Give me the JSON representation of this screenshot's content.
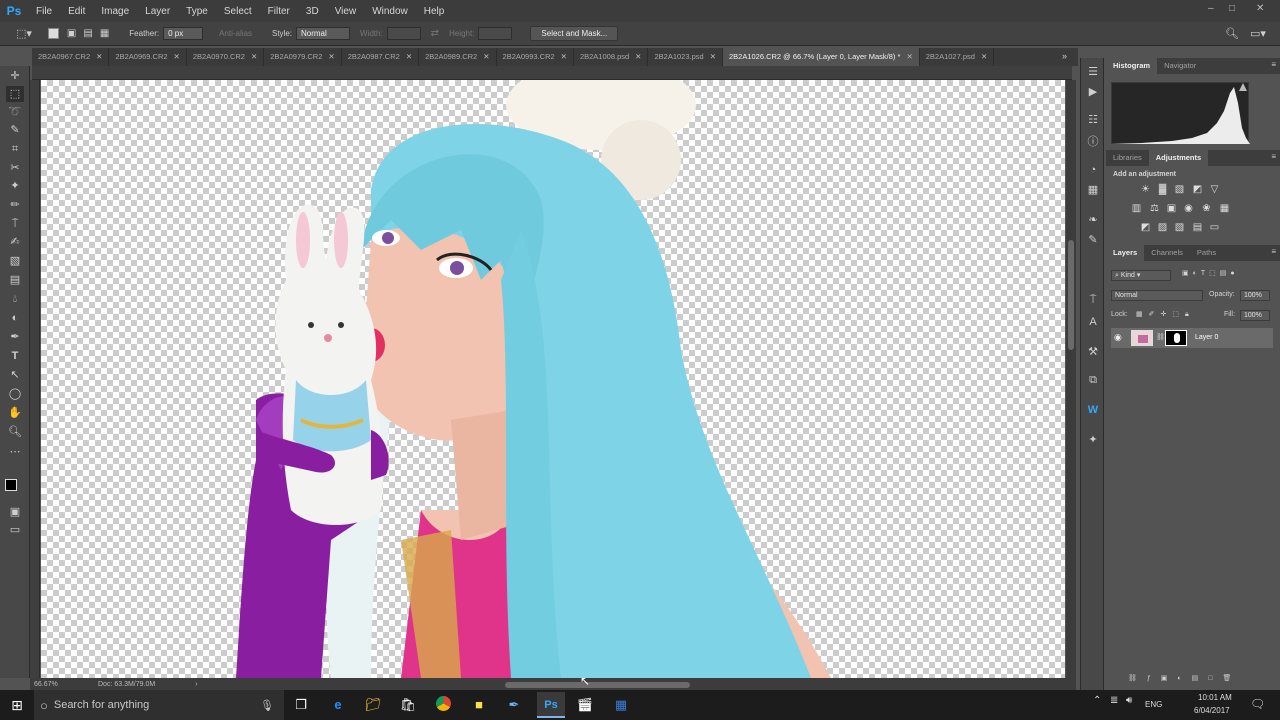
{
  "app": {
    "logo": "Ps"
  },
  "menu": [
    "File",
    "Edit",
    "Image",
    "Layer",
    "Type",
    "Select",
    "Filter",
    "3D",
    "View",
    "Window",
    "Help"
  ],
  "window_controls": [
    "–",
    "□",
    "✕"
  ],
  "options": {
    "feather_label": "Feather:",
    "feather_value": "0 px",
    "antialias_label": "Anti-alias",
    "style_label": "Style:",
    "style_value": "Normal",
    "width_label": "Width:",
    "height_label": "Height:",
    "select_mask_button": "Select and Mask..."
  },
  "tabs": [
    {
      "label": "2B2A0967.CR2",
      "active": false
    },
    {
      "label": "2B2A0969.CR2",
      "active": false
    },
    {
      "label": "2B2A0970.CR2",
      "active": false
    },
    {
      "label": "2B2A0979.CR2",
      "active": false
    },
    {
      "label": "2B2A0987.CR2",
      "active": false
    },
    {
      "label": "2B2A0989.CR2",
      "active": false
    },
    {
      "label": "2B2A0993.CR2",
      "active": false
    },
    {
      "label": "2B2A1008.psd",
      "active": false
    },
    {
      "label": "2B2A1023.psd",
      "active": false
    },
    {
      "label": "2B2A1026.CR2 @ 66.7% (Layer 0, Layer Mask/8) *",
      "active": true
    },
    {
      "label": "2B2A1027.psd",
      "active": false
    }
  ],
  "status": {
    "zoom": "66.67%",
    "doc": "Doc: 63.3M/79.0M"
  },
  "panels": {
    "histogram_tab": "Histogram",
    "navigator_tab": "Navigator",
    "libraries_tab": "Libraries",
    "adjustments_tab": "Adjustments",
    "add_adjustment": "Add an adjustment",
    "layers_tab": "Layers",
    "channels_tab": "Channels",
    "paths_tab": "Paths",
    "kind_filter": "Kind",
    "blend_mode": "Normal",
    "opacity_label": "Opacity:",
    "opacity_value": "100%",
    "lock_label": "Lock:",
    "fill_label": "Fill:",
    "fill_value": "100%",
    "layer_name": "Layer 0"
  },
  "taskbar": {
    "search_placeholder": "Search for anything",
    "language": "ENG",
    "time": "10:01 AM",
    "date": "6/04/2017"
  },
  "colors": {
    "hair": "#7fd3e6",
    "skin": "#f2c3b0",
    "glove": "#8a1ea0",
    "top": "#e0348a",
    "ps_blue": "#31a8ff"
  }
}
